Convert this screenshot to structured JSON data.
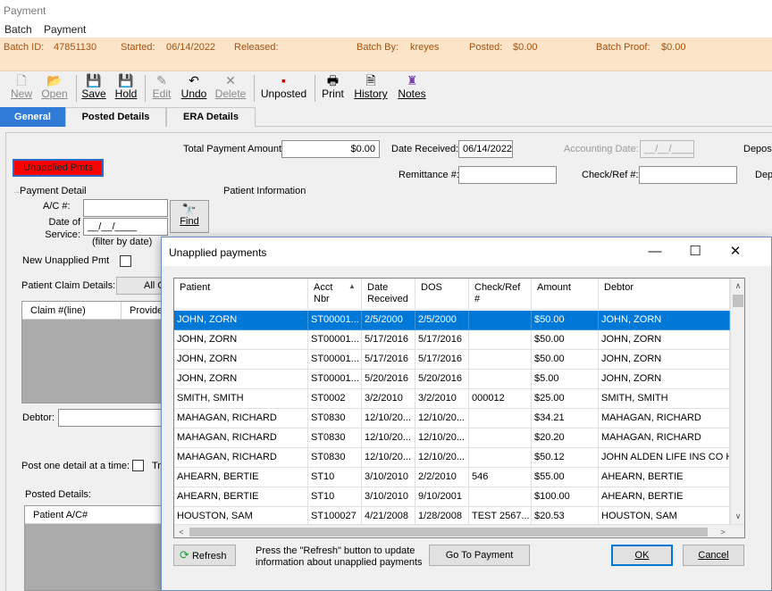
{
  "window": {
    "title": "Payment"
  },
  "menu": [
    "Batch",
    "Payment"
  ],
  "batch_bar": {
    "batch_id_label": "Batch ID:",
    "batch_id": "47851130",
    "started_label": "Started:",
    "started": "06/14/2022",
    "released_label": "Released:",
    "batch_by_label": "Batch By:",
    "batch_by": "kreyes",
    "posted_label": "Posted:",
    "posted": "$0.00",
    "batch_proof_label": "Batch Proof:",
    "batch_proof": "$0.00"
  },
  "toolbar": {
    "new": "New",
    "open": "Open",
    "save": "Save",
    "hold": "Hold",
    "edit": "Edit",
    "undo": "Undo",
    "delete": "Delete",
    "unposted": "Unposted",
    "print": "Print",
    "history": "History",
    "notes": "Notes"
  },
  "tabs": [
    "General",
    "Posted Details",
    "ERA Details"
  ],
  "form": {
    "total_payment_label": "Total Payment Amount:",
    "total_payment": "$0.00",
    "date_received_label": "Date Received:",
    "date_received": "06/14/2022",
    "accounting_date_label": "Accounting Date:",
    "accounting_date": "__/__/____",
    "deposit_label": "Deposi",
    "unapplied_btn": "Unapplied Pmts",
    "remittance_label": "Remittance #:",
    "check_ref_label": "Check/Ref #:",
    "dep_label": "Dep",
    "payment_detail_label": "Payment Detail",
    "patient_info_label": "Patient Information",
    "ac_label": "A/C #:",
    "date_of_service_label": "Date of Service:",
    "date_of_service": "__/__/____",
    "filter_note": "(filter by date)",
    "find_btn": "Find",
    "new_unapplied_label": "New Unapplied Pmt",
    "patient_claim_label": "Patient Claim Details:",
    "all_claims_btn": "All C",
    "claim_col": "Claim #(line)",
    "provider_col": "Provide",
    "debtor_label": "Debtor:",
    "post_one_label": "Post one detail at a time:",
    "tr_label": "Tr",
    "posted_details_label": "Posted Details:",
    "patient_ac_col": "Patient A/C#"
  },
  "dialog": {
    "title": "Unapplied payments",
    "columns": [
      "Patient",
      "Acct Nbr",
      "Date Received",
      "DOS",
      "Check/Ref #",
      "Amount",
      "Debtor"
    ],
    "rows": [
      [
        "JOHN, ZORN",
        "ST00001...",
        "2/5/2000",
        "2/5/2000",
        "",
        "$50.00",
        "JOHN, ZORN"
      ],
      [
        "JOHN, ZORN",
        "ST00001...",
        "5/17/2016",
        "5/17/2016",
        "",
        "$50.00",
        "JOHN, ZORN"
      ],
      [
        "JOHN, ZORN",
        "ST00001...",
        "5/17/2016",
        "5/17/2016",
        "",
        "$50.00",
        "JOHN, ZORN"
      ],
      [
        "JOHN, ZORN",
        "ST00001...",
        "5/20/2016",
        "5/20/2016",
        "",
        "$5.00",
        "JOHN, ZORN"
      ],
      [
        "SMITH, SMITH",
        "ST0002",
        "3/2/2010",
        "3/2/2010",
        "000012",
        "$25.00",
        "SMITH, SMITH"
      ],
      [
        "MAHAGAN, RICHARD",
        "ST0830",
        "12/10/20...",
        "12/10/20...",
        "",
        "$34.21",
        "MAHAGAN, RICHARD"
      ],
      [
        "MAHAGAN, RICHARD",
        "ST0830",
        "12/10/20...",
        "12/10/20...",
        "",
        "$20.20",
        "MAHAGAN, RICHARD"
      ],
      [
        "MAHAGAN, RICHARD",
        "ST0830",
        "12/10/20...",
        "12/10/20...",
        "",
        "$50.12",
        "JOHN ALDEN LIFE INS CO H..."
      ],
      [
        "AHEARN, BERTIE",
        "ST10",
        "3/10/2010",
        "2/2/2010",
        "546",
        "$55.00",
        "AHEARN, BERTIE"
      ],
      [
        "AHEARN, BERTIE",
        "ST10",
        "3/10/2010",
        "9/10/2001",
        "",
        "$100.00",
        "AHEARN, BERTIE"
      ],
      [
        "HOUSTON, SAM",
        "ST100027",
        "4/21/2008",
        "1/28/2008",
        "TEST 2567...",
        "$20.53",
        "HOUSTON, SAM"
      ]
    ],
    "selected_row": 0,
    "refresh_btn": "Refresh",
    "refresh_hint": "Press the \"Refresh\" button to update information about unapplied payments",
    "goto_btn": "Go To Payment",
    "ok_btn": "OK",
    "cancel_btn": "Cancel"
  },
  "colors": {
    "accent": "#0078d7",
    "batch_bar": "#fce4c8",
    "batch_text": "#a2520e",
    "alert": "#ff0000"
  }
}
